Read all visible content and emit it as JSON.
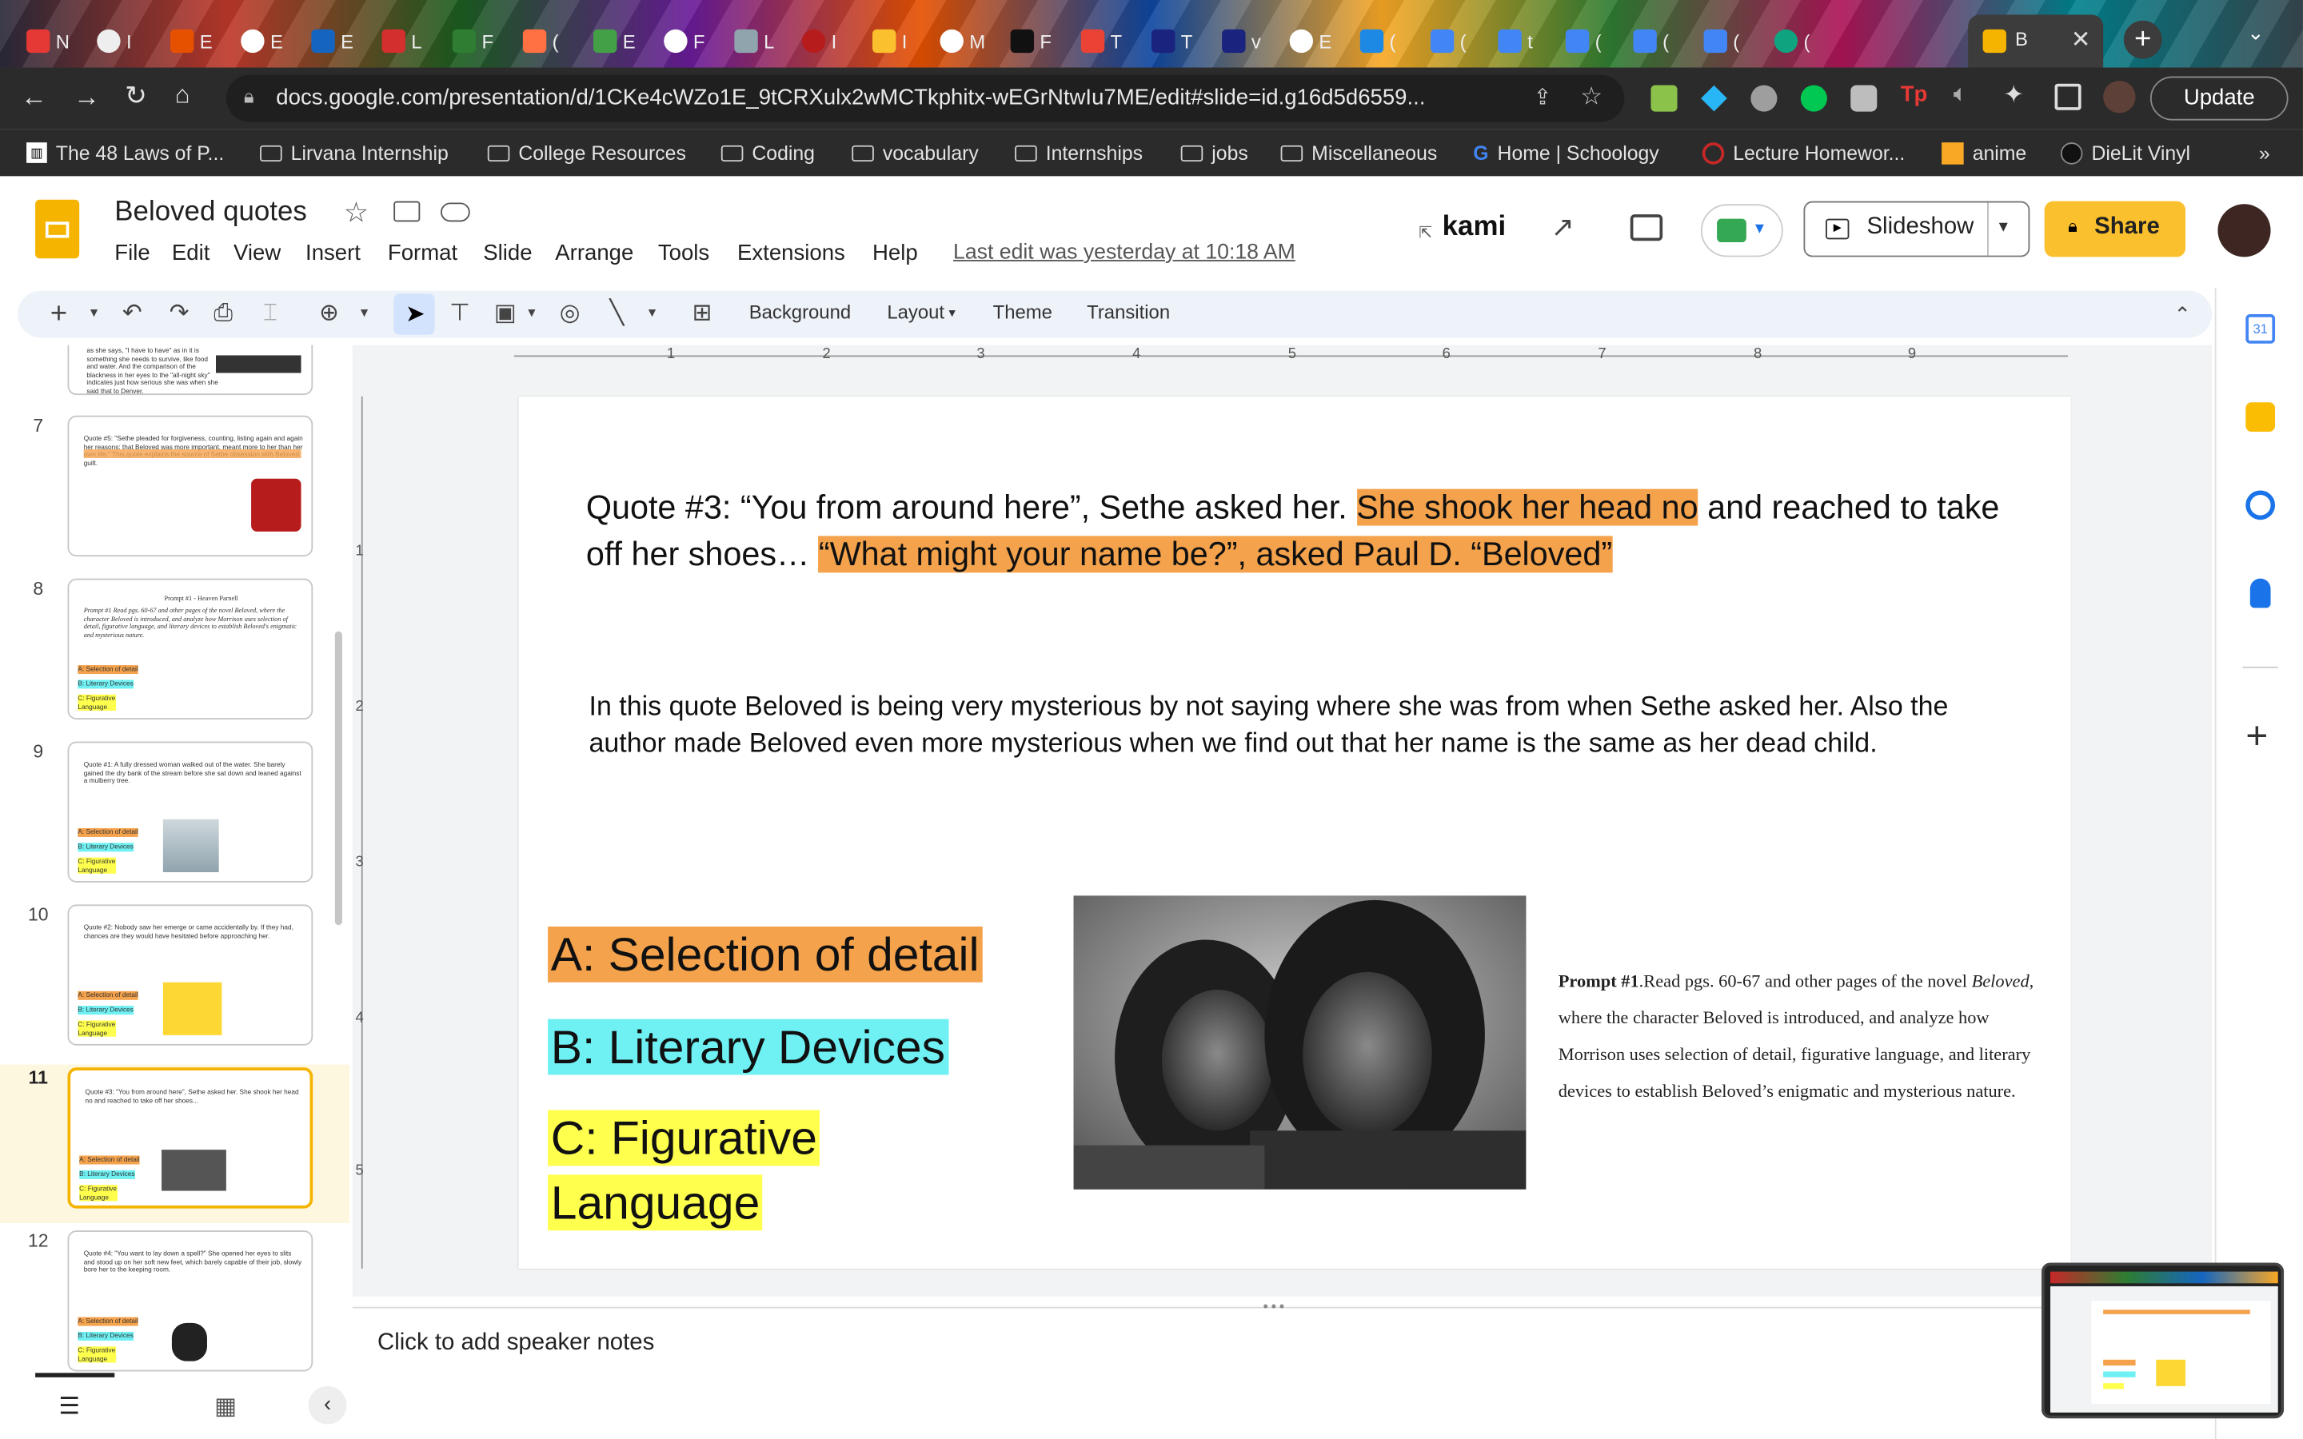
{
  "browser": {
    "tabs": [
      "N",
      "I",
      "E",
      "E",
      "E",
      "L",
      "F",
      "(",
      "E",
      "F",
      "L",
      "I",
      "I",
      "M",
      "F",
      "T",
      "T",
      "v",
      "E",
      "(",
      "(",
      "t",
      "(",
      "(",
      "(",
      "(",
      "B"
    ],
    "url": "docs.google.com/presentation/d/1CKe4cWZo1E_9tCRXulx2wMCTkphitx-wEGrNtwIu7ME/edit#slide=id.g16d5d6559...",
    "update_label": "Update",
    "bookmarks": [
      "The 48 Laws of P...",
      "Lirvana Internship",
      "College Resources",
      "Coding",
      "vocabulary",
      "Internships",
      "jobs",
      "Miscellaneous",
      "Home | Schoology",
      "Lecture Homewor...",
      "anime",
      "DieLit Vinyl"
    ],
    "more_bookmarks": "»"
  },
  "doc": {
    "title": "Beloved quotes",
    "menu": [
      "File",
      "Edit",
      "View",
      "Insert",
      "Format",
      "Slide",
      "Arrange",
      "Tools",
      "Extensions",
      "Help"
    ],
    "last_edit": "Last edit was yesterday at 10:18 AM",
    "kami_label": "kami",
    "slideshow_label": "Slideshow",
    "share_label": "Share",
    "toolbar": {
      "background": "Background",
      "layout": "Layout",
      "theme": "Theme",
      "transition": "Transition"
    }
  },
  "filmstrip": {
    "top_partial_text": "as she says, \"I have to have\" as in it is something she needs to survive, like food and water. And the comparison of the blackness in her eyes to the \"all-night sky\" indicates just how serious she was when she said that to Denver.",
    "slides": [
      {
        "num": "7",
        "text": "Quote #5: \"Sethe pleaded for forgiveness, counting, listing again and again her reasons: that Beloved was more important, meant more to her than her own life.\" This quote explains the source of Sethe obsession with Beloved: guilt."
      },
      {
        "num": "8",
        "text": "Prompt #1 Read pgs. 60-67 and other pages of the novel Beloved, where the character Beloved is introduced, and analyze how Morrison uses selection of detail, figurative language, and literary devices to establish Beloved's enigmatic and mysterious nature."
      },
      {
        "num": "9",
        "text": "Quote #1: A fully dressed woman walked out of the water. She barely gained the dry bank of the stream before she sat down and leaned against a mulberry tree."
      },
      {
        "num": "10",
        "text": "Quote #2: Nobody saw her emerge or came accidentally by. If they had, chances are they would have hesitated before approaching her."
      },
      {
        "num": "11",
        "text": "Quote #3: \"You from around here\", Sethe asked her. She shook her head no and reached to take off her shoes..."
      },
      {
        "num": "12",
        "text": "Quote #4: \"You want to lay down a spell?\" She opened her eyes to slits and stood up on her soft new feet, which barely capable of their job, slowly bore her to the keeping room."
      }
    ],
    "legend_a": "A: Selection of detail",
    "legend_b": "B: Literary Devices",
    "legend_c": "C: Figurative Language",
    "thumb_label_prompt": "Prompt #1 - Heaven Parnell"
  },
  "ruler": {
    "h": [
      "1",
      "2",
      "3",
      "4",
      "5",
      "6",
      "7",
      "8",
      "9"
    ],
    "v": [
      "1",
      "2",
      "3",
      "4",
      "5"
    ]
  },
  "slide": {
    "quote_lead": "Quote #3: “You from around here”, Sethe asked her.",
    "quote_hl1": "She shook her head no",
    "quote_mid": "and reached to take off her shoes…",
    "quote_hl2": "“What might your name be?”, asked Paul D. “Beloved”",
    "analysis": "In this quote Beloved is being very mysterious by not saying where she was from when Sethe asked her. Also the author made Beloved even more mysterious when we find out that her name is the same as her dead child.",
    "label_a": "A: Selection of detail",
    "label_b": "B: Literary Devices",
    "label_c1": "C: Figurative",
    "label_c2": "Language",
    "prompt_bold": "Prompt #1",
    "prompt_text1": ".Read pgs. 60-67 and other pages of the novel",
    "prompt_italic": "Beloved",
    "prompt_text2": ", where the character Beloved is introduced, and analyze how Morrison uses selection of detail, figurative language, and literary devices to establish Beloved’s enigmatic and mysterious nature."
  },
  "notes": {
    "placeholder": "Click to add speaker notes"
  },
  "colors": {
    "highlight_orange": "#f4a24c",
    "highlight_cyan": "#6ff0f3",
    "highlight_yellow": "#ffff4d",
    "share_yellow": "#fbc02d",
    "selected_border": "#f4b400"
  }
}
